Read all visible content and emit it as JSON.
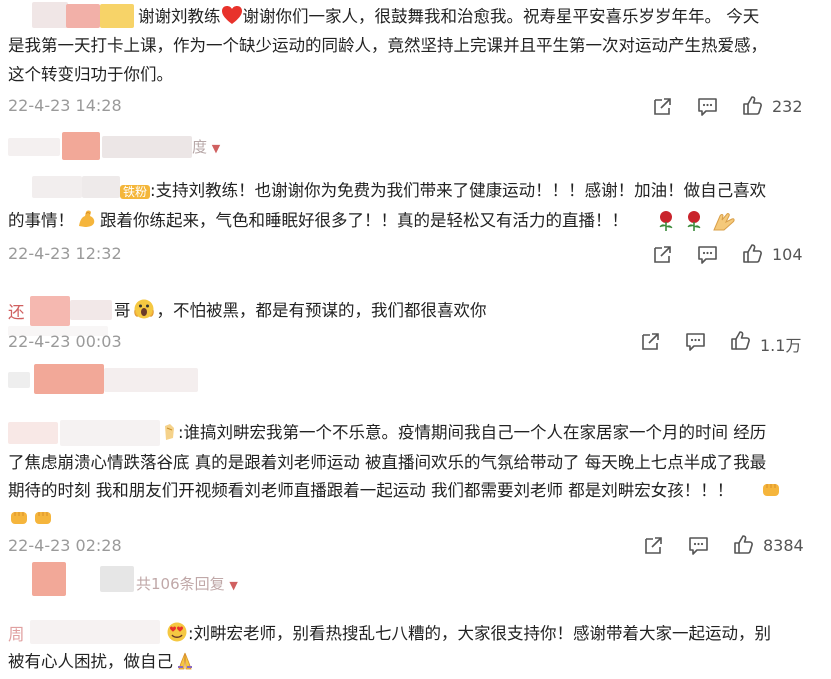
{
  "comments": [
    {
      "text_line1": "谢谢刘教练",
      "text_line1b": "谢谢你们一家人，很鼓舞我和治愈我。祝寿星平安喜乐岁岁年年。 今天",
      "text_line2": "是我第一天打卡上课，作为一个缺少运动的同龄人，竟然坚持上完课并且平生第一次对运动产生热爱感，",
      "text_line3": "这个转变归功于你们。",
      "date": "22-4-23 14:28",
      "likes": "232"
    },
    {
      "badge": "铁粉",
      "text_line1": ":支持刘教练！也谢谢你为免费为我们带来了健康运动！！！感谢！加油！做自己喜欢",
      "text_line2a": "的事情！",
      "text_line2b": "跟着你练起来，气色和睡眠好很多了！！真的是轻松又有活力的直播！！",
      "date": "22-4-23 12:32",
      "likes": "104"
    },
    {
      "name_prefix": "还",
      "text_line1a": "哥",
      "text_line1b": "，不怕被黑，都是有预谋的，我们都很喜欢你",
      "date": "22-4-23 00:03",
      "likes": "1.1万"
    },
    {
      "text_line1": ":谁搞刘畊宏我第一个不乐意。疫情期间我自己一个人在家居家一个月的时间 经历",
      "text_line2": "了焦虑崩溃心情跌落谷底 真的是跟着刘老师运动 被直播间欢乐的气氛给带动了 每天晚上七点半成了我最",
      "text_line3": "期待的时刻 我和朋友们开视频看刘老师直播跟着一起运动 我们都需要刘老师 都是刘畊宏女孩！！！",
      "date": "22-4-23 02:28",
      "likes": "8384"
    },
    {
      "reply_more": "共106条回复",
      "name_prefix": "周",
      "text_line1": ":刘畊宏老师，别看热搜乱七八糟的，大家很支持你！感谢带着大家一起运动，别",
      "text_line2": "被有心人困扰，做自己"
    }
  ],
  "reply_more_2": "度",
  "icons": [
    "share-icon",
    "comment-icon",
    "like-icon",
    "heart-emoji",
    "muscle-emoji",
    "rose-emoji",
    "clap-emoji",
    "fist-emoji",
    "scream-emoji",
    "pray-emoji"
  ],
  "colors": {
    "accent_heart": "#e8322b",
    "rose": "#c9242c",
    "emoji_yellow": "#f5b53c"
  }
}
